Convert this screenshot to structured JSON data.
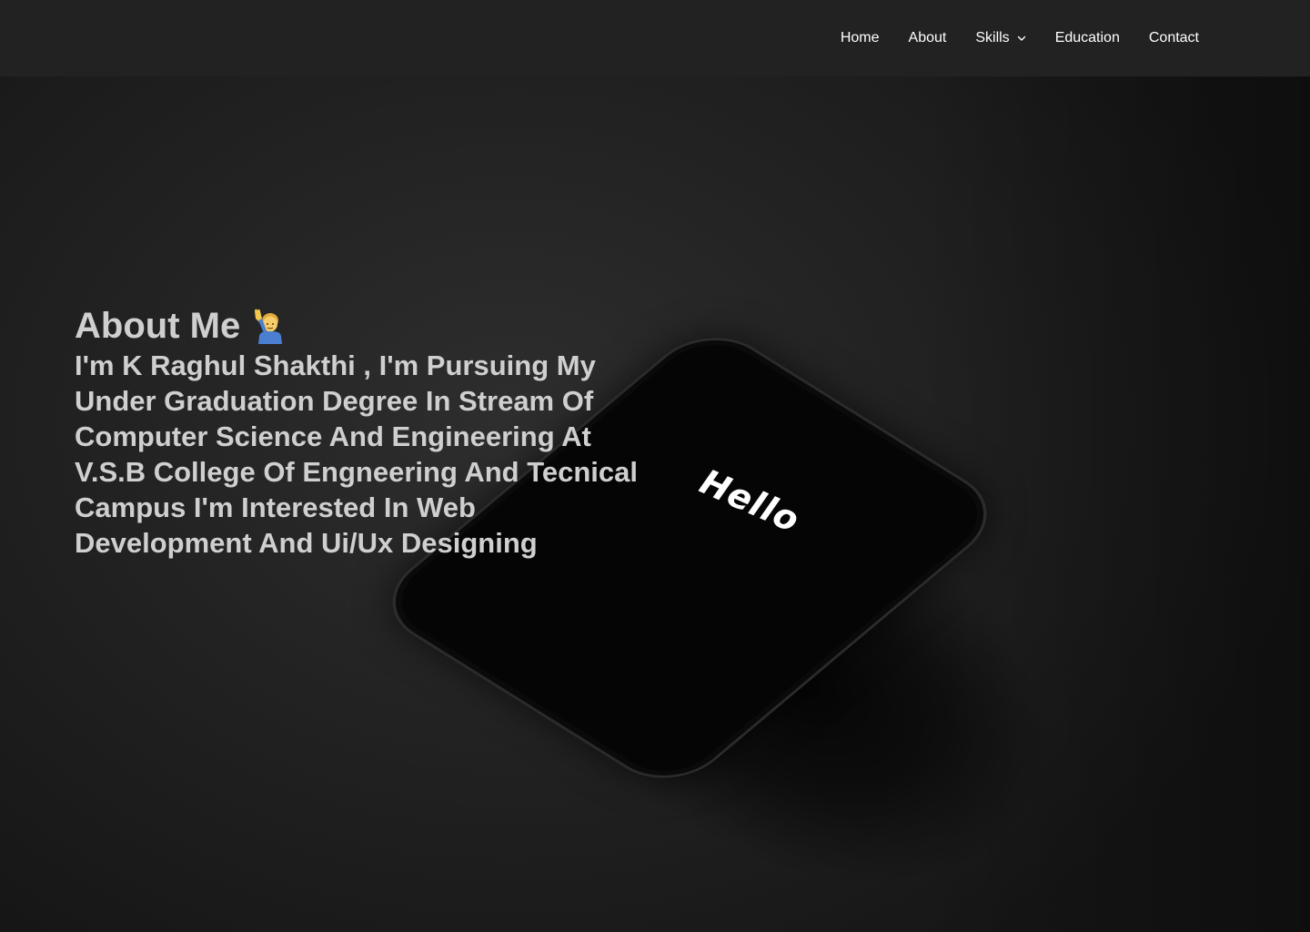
{
  "nav": {
    "items": [
      {
        "label": "Home"
      },
      {
        "label": "About"
      },
      {
        "label": "Skills",
        "has_dropdown": true
      },
      {
        "label": "Education"
      },
      {
        "label": "Contact"
      }
    ]
  },
  "about": {
    "title": "About Me",
    "title_icon": "person-raising-hand-icon",
    "body": "I'm K Raghul Shakthi , I'm Pursuing My Under Graduation Degree In Stream Of Computer Science And Engineering At V.S.B College Of Engneering And Tecnical Campus I'm Interested In Web Development And Ui/Ux Designing"
  },
  "hero_image": {
    "phone_text": "Hello"
  },
  "colors": {
    "header_bg": "#222222",
    "text_primary": "#ffffff",
    "text_about": "#cfcfcf"
  }
}
